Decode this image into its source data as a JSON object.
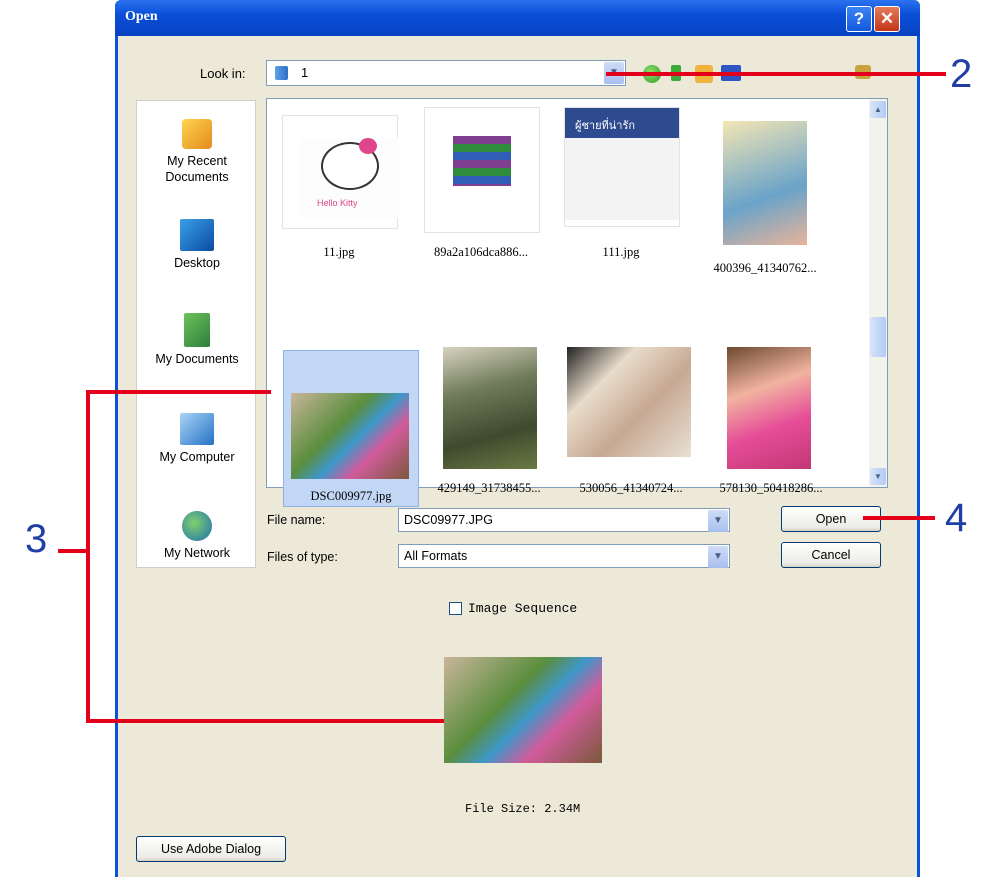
{
  "window": {
    "title": "Open",
    "help_glyph": "?",
    "close_glyph": "✕"
  },
  "lookin": {
    "label": "Look in:",
    "value": "1"
  },
  "places": [
    {
      "label": "My Recent\nDocuments",
      "icon": "recent-docs-icon"
    },
    {
      "label": "Desktop",
      "icon": "desktop-icon"
    },
    {
      "label": "My Documents",
      "icon": "my-documents-icon"
    },
    {
      "label": "My Computer",
      "icon": "my-computer-icon"
    },
    {
      "label": "My Network",
      "icon": "my-network-icon"
    }
  ],
  "files": [
    {
      "name": "11.jpg"
    },
    {
      "name": "89a2a106dca886..."
    },
    {
      "name": "111.jpg"
    },
    {
      "name": "400396_41340762..."
    },
    {
      "name": "DSC009977.jpg",
      "selected": true
    },
    {
      "name": "429149_31738455..."
    },
    {
      "name": "530056_41340724..."
    },
    {
      "name": "578130_50418286..."
    }
  ],
  "poster_text": "ผู้ชายที่น่ารัก",
  "kitty_text": "Hello Kitty",
  "file_name": {
    "label": "File name:",
    "value": "DSC09977.JPG"
  },
  "files_of_type": {
    "label": "Files of type:",
    "value": "All Formats"
  },
  "buttons": {
    "open": "Open",
    "cancel": "Cancel",
    "adobe": "Use Adobe Dialog"
  },
  "image_sequence": {
    "label": "Image Sequence",
    "checked": false
  },
  "file_size": "File Size: 2.34M",
  "annotations": {
    "n2": "2",
    "n3": "3",
    "n4": "4"
  },
  "colors": {
    "titlebar": "#0a52dc",
    "dialog_bg": "#ece9d8",
    "annotation_line": "#e3001b",
    "annotation_number": "#1f3fa6"
  }
}
